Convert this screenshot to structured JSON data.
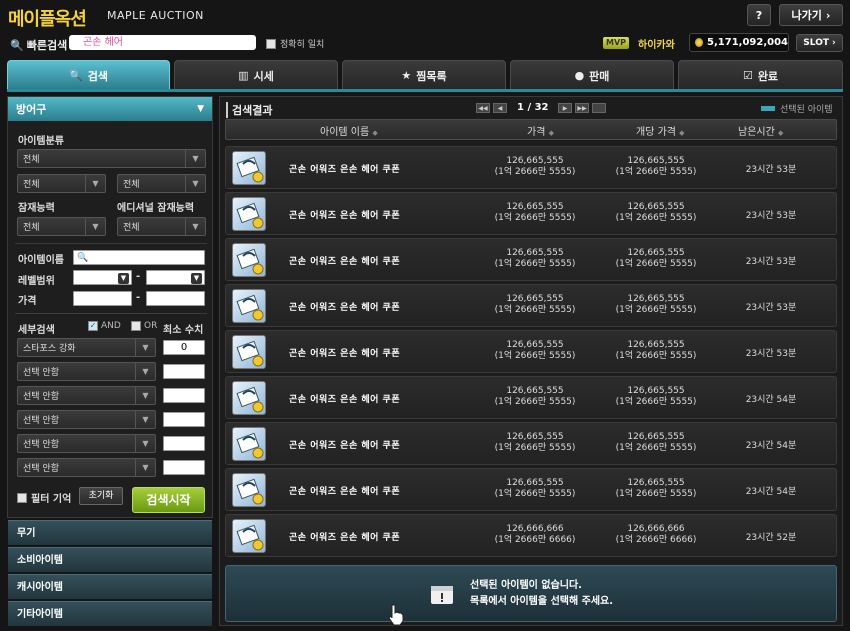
{
  "header": {
    "logo": "메이플옥션",
    "logo_sub": "MAPLE AUCTION",
    "help": "?",
    "exit": "나가기",
    "quick_label": "빠른검색",
    "quick_value": "곤손 헤어",
    "exact_match": "정확히 일치",
    "mvp": "MVP",
    "username": "하이카와",
    "meso": "5,171,092,004",
    "slot": "SLOT"
  },
  "tabs": [
    "검색",
    "시세",
    "찜목록",
    "판매",
    "완료"
  ],
  "left": {
    "head": "방어구",
    "item_class_label": "아이템분류",
    "class_main": "전체",
    "class_sub1": "전체",
    "class_sub2": "전체",
    "potential_label": "잠재능력",
    "additional_label": "에디셔널 잠재능력",
    "potential": "전체",
    "additional": "전체",
    "item_name_label": "아이템이름",
    "level_label": "레벨범위",
    "price_label": "가격",
    "dash": "-",
    "detail_label": "세부검색",
    "and_label": "AND",
    "or_label": "OR",
    "min_label": "최소 수치",
    "options": [
      "스타포스 강화",
      "선택 안함",
      "선택 안함",
      "선택 안함",
      "선택 안함",
      "선택 안함"
    ],
    "starforce_value": "0",
    "filter_memory": "필터 기억",
    "reset": "초기화",
    "search": "검색시작",
    "categories": [
      "무기",
      "소비아이템",
      "캐시아이템",
      "기타아이템"
    ]
  },
  "results": {
    "title": "검색결과",
    "page": "1 / 32",
    "selected_legend": "선택된 아이템",
    "columns": [
      "아이템 이름",
      "가격",
      "개당 가격",
      "남은시간"
    ],
    "rows": [
      {
        "name": "곤손 어워즈 은손 헤어 쿠폰",
        "price": "126,665,555",
        "price_kr": "(1억 2666만 5555)",
        "unit": "126,665,555",
        "unit_kr": "(1억 2666만 5555)",
        "time": "23시간 53분"
      },
      {
        "name": "곤손 어워즈 은손 헤어 쿠폰",
        "price": "126,665,555",
        "price_kr": "(1억 2666만 5555)",
        "unit": "126,665,555",
        "unit_kr": "(1억 2666만 5555)",
        "time": "23시간 53분"
      },
      {
        "name": "곤손 어워즈 은손 헤어 쿠폰",
        "price": "126,665,555",
        "price_kr": "(1억 2666만 5555)",
        "unit": "126,665,555",
        "unit_kr": "(1억 2666만 5555)",
        "time": "23시간 53분"
      },
      {
        "name": "곤손 어워즈 은손 헤어 쿠폰",
        "price": "126,665,555",
        "price_kr": "(1억 2666만 5555)",
        "unit": "126,665,555",
        "unit_kr": "(1억 2666만 5555)",
        "time": "23시간 53분"
      },
      {
        "name": "곤손 어워즈 은손 헤어 쿠폰",
        "price": "126,665,555",
        "price_kr": "(1억 2666만 5555)",
        "unit": "126,665,555",
        "unit_kr": "(1억 2666만 5555)",
        "time": "23시간 53분"
      },
      {
        "name": "곤손 어워즈 은손 헤어 쿠폰",
        "price": "126,665,555",
        "price_kr": "(1억 2666만 5555)",
        "unit": "126,665,555",
        "unit_kr": "(1억 2666만 5555)",
        "time": "23시간 54분"
      },
      {
        "name": "곤손 어워즈 은손 헤어 쿠폰",
        "price": "126,665,555",
        "price_kr": "(1억 2666만 5555)",
        "unit": "126,665,555",
        "unit_kr": "(1억 2666만 5555)",
        "time": "23시간 54분"
      },
      {
        "name": "곤손 어워즈 은손 헤어 쿠폰",
        "price": "126,665,555",
        "price_kr": "(1억 2666만 5555)",
        "unit": "126,665,555",
        "unit_kr": "(1억 2666만 5555)",
        "time": "23시간 54분"
      },
      {
        "name": "곤손 어워즈 은손 헤어 쿠폰",
        "price": "126,666,666",
        "price_kr": "(1억 2666만 6666)",
        "unit": "126,666,666",
        "unit_kr": "(1억 2666만 6666)",
        "time": "23시간 52분"
      }
    ],
    "detail_line1": "선택된 아이템이 없습니다.",
    "detail_line2": "목록에서 아이템을 선택해 주세요."
  }
}
